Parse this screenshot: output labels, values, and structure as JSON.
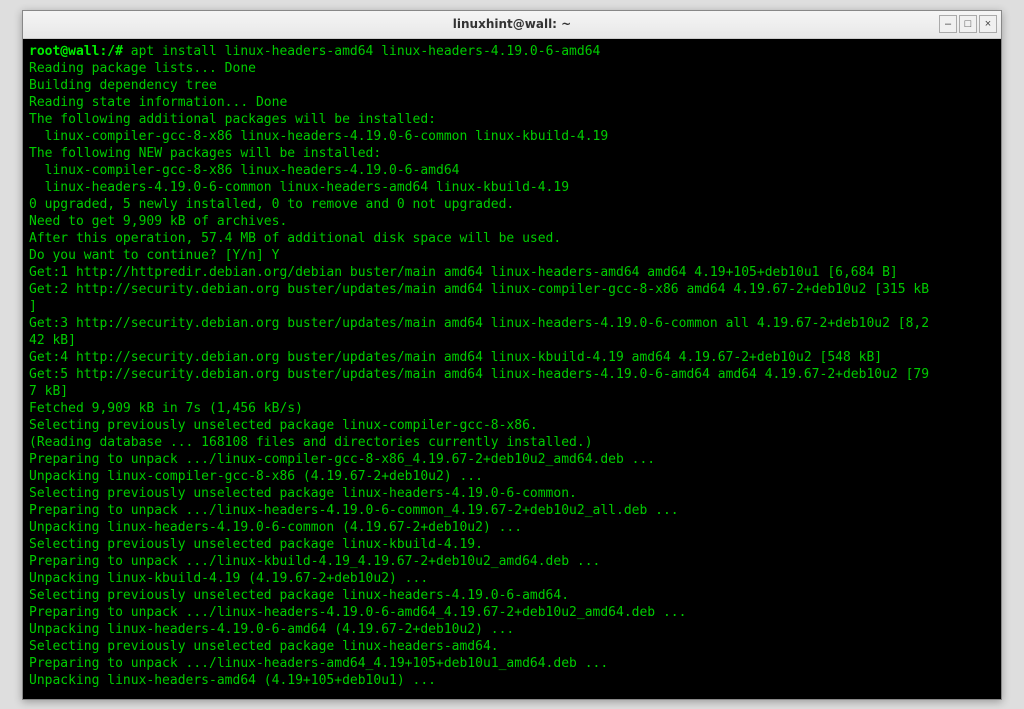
{
  "window": {
    "title": "linuxhint@wall: ~",
    "btn_min": "–",
    "btn_max": "□",
    "btn_close": "×"
  },
  "terminal": {
    "prompt": "root@wall:/# ",
    "command": "apt install linux-headers-amd64 linux-headers-4.19.0-6-amd64",
    "lines": [
      "Reading package lists... Done",
      "Building dependency tree",
      "Reading state information... Done",
      "The following additional packages will be installed:",
      "  linux-compiler-gcc-8-x86 linux-headers-4.19.0-6-common linux-kbuild-4.19",
      "The following NEW packages will be installed:",
      "  linux-compiler-gcc-8-x86 linux-headers-4.19.0-6-amd64",
      "  linux-headers-4.19.0-6-common linux-headers-amd64 linux-kbuild-4.19",
      "0 upgraded, 5 newly installed, 0 to remove and 0 not upgraded.",
      "Need to get 9,909 kB of archives.",
      "After this operation, 57.4 MB of additional disk space will be used.",
      "Do you want to continue? [Y/n] Y",
      "Get:1 http://httpredir.debian.org/debian buster/main amd64 linux-headers-amd64 amd64 4.19+105+deb10u1 [6,684 B]",
      "Get:2 http://security.debian.org buster/updates/main amd64 linux-compiler-gcc-8-x86 amd64 4.19.67-2+deb10u2 [315 kB",
      "]",
      "Get:3 http://security.debian.org buster/updates/main amd64 linux-headers-4.19.0-6-common all 4.19.67-2+deb10u2 [8,2",
      "42 kB]",
      "Get:4 http://security.debian.org buster/updates/main amd64 linux-kbuild-4.19 amd64 4.19.67-2+deb10u2 [548 kB]",
      "Get:5 http://security.debian.org buster/updates/main amd64 linux-headers-4.19.0-6-amd64 amd64 4.19.67-2+deb10u2 [79",
      "7 kB]",
      "Fetched 9,909 kB in 7s (1,456 kB/s)",
      "Selecting previously unselected package linux-compiler-gcc-8-x86.",
      "(Reading database ... 168108 files and directories currently installed.)",
      "Preparing to unpack .../linux-compiler-gcc-8-x86_4.19.67-2+deb10u2_amd64.deb ...",
      "Unpacking linux-compiler-gcc-8-x86 (4.19.67-2+deb10u2) ...",
      "Selecting previously unselected package linux-headers-4.19.0-6-common.",
      "Preparing to unpack .../linux-headers-4.19.0-6-common_4.19.67-2+deb10u2_all.deb ...",
      "Unpacking linux-headers-4.19.0-6-common (4.19.67-2+deb10u2) ...",
      "Selecting previously unselected package linux-kbuild-4.19.",
      "Preparing to unpack .../linux-kbuild-4.19_4.19.67-2+deb10u2_amd64.deb ...",
      "Unpacking linux-kbuild-4.19 (4.19.67-2+deb10u2) ...",
      "Selecting previously unselected package linux-headers-4.19.0-6-amd64.",
      "Preparing to unpack .../linux-headers-4.19.0-6-amd64_4.19.67-2+deb10u2_amd64.deb ...",
      "Unpacking linux-headers-4.19.0-6-amd64 (4.19.67-2+deb10u2) ...",
      "Selecting previously unselected package linux-headers-amd64.",
      "Preparing to unpack .../linux-headers-amd64_4.19+105+deb10u1_amd64.deb ...",
      "Unpacking linux-headers-amd64 (4.19+105+deb10u1) ..."
    ]
  }
}
